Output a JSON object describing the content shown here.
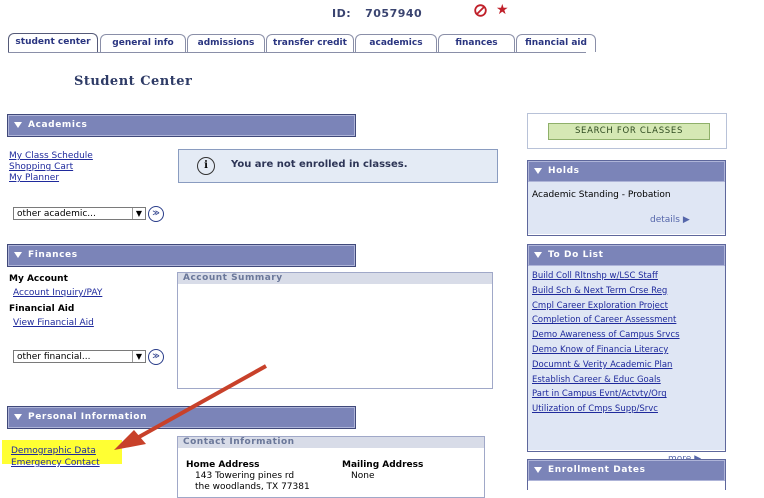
{
  "header": {
    "id_label": "ID:",
    "id_value": "7057940",
    "icons": [
      "no-entry-icon",
      "star-icon"
    ],
    "accent": "#c0202a"
  },
  "tabs": [
    {
      "label": "student center",
      "active": true
    },
    {
      "label": "general info"
    },
    {
      "label": "admissions"
    },
    {
      "label": "transfer credit"
    },
    {
      "label": "academics"
    },
    {
      "label": "finances"
    },
    {
      "label": "financial aid"
    }
  ],
  "page_title": "Student Center",
  "academics": {
    "header": "Academics",
    "links": [
      "My Class Schedule",
      "Shopping Cart",
      "My Planner"
    ],
    "select_value": "other academic...",
    "info_message": "You are not enrolled in classes."
  },
  "finances": {
    "header": "Finances",
    "my_account": "My Account",
    "account_link": "Account Inquiry/PAY",
    "financial_aid": "Financial Aid",
    "aid_link": "View Financial Aid",
    "select_value": "other financial...",
    "summary_title": "Account Summary"
  },
  "personal": {
    "header": "Personal Information",
    "links": [
      "Demographic Data",
      "Emergency Contact"
    ],
    "contact_title": "Contact Information",
    "home_address_label": "Home Address",
    "home_line1": "143 Towering pines rd",
    "home_line2": "the woodlands, TX 77381",
    "mailing_address_label": "Mailing Address",
    "mailing_value": "None"
  },
  "search_button": "SEARCH FOR CLASSES",
  "holds": {
    "header": "Holds",
    "item": "Academic Standing - Probation",
    "details": "details"
  },
  "todo": {
    "header": "To Do List",
    "items": [
      "Build Coll Rltnshp w/LSC Staff",
      "Build Sch & Next Term Crse Reg",
      "Cmpl Career Exploration Project",
      "Completion of Career Assessment",
      "Demo Awareness of Campus Srvcs",
      "Demo Know of Financia Literacy",
      "Documnt & Verity Academic Plan",
      "Establish Career & Educ Goals",
      "Part in Campus Evnt/Actvty/Org",
      "Utilization of Cmps Supp/Srvc"
    ],
    "more": "more"
  },
  "enrollment_dates": {
    "header": "Enrollment Dates"
  },
  "colors": {
    "section_header": "#7b84b8",
    "annotation_arrow": "#c8412a",
    "highlight": "#ffff33"
  }
}
